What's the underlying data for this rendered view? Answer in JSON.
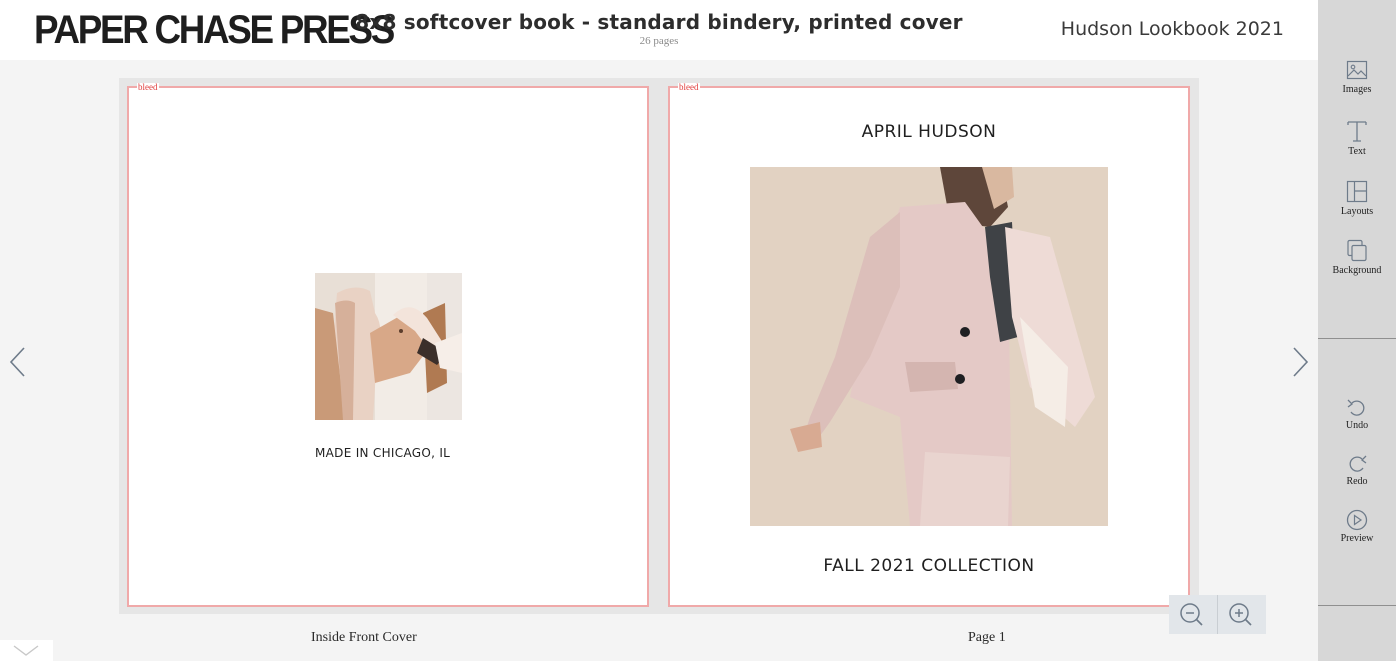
{
  "header": {
    "logo": "PAPER CHASE PRESS",
    "title": "8x8 softcover book - standard bindery, printed cover",
    "subtitle": "26 pages",
    "project_name": "Hudson Lookbook 2021"
  },
  "toolbar": {
    "tools": [
      {
        "label": "Images",
        "icon": "image-icon"
      },
      {
        "label": "Text",
        "icon": "text-icon"
      },
      {
        "label": "Layouts",
        "icon": "layout-icon"
      },
      {
        "label": "Background",
        "icon": "background-icon"
      }
    ],
    "actions": [
      {
        "label": "Undo",
        "icon": "undo-icon"
      },
      {
        "label": "Redo",
        "icon": "redo-icon"
      },
      {
        "label": "Preview",
        "icon": "play-icon"
      }
    ]
  },
  "spread": {
    "bleed_label": "bleed",
    "left_page": {
      "label": "Inside Front Cover",
      "caption": "MADE IN CHICAGO, IL"
    },
    "right_page": {
      "label": "Page 1",
      "heading": "APRIL HUDSON",
      "footer": "FALL 2021 COLLECTION"
    }
  },
  "colors": {
    "bleed_border": "#f0a9a9",
    "bleed_text": "#e03a3a",
    "sidebar": "#d7d7d7",
    "canvas": "#f4f4f4",
    "zoom_bg": "#e2e6ea"
  }
}
